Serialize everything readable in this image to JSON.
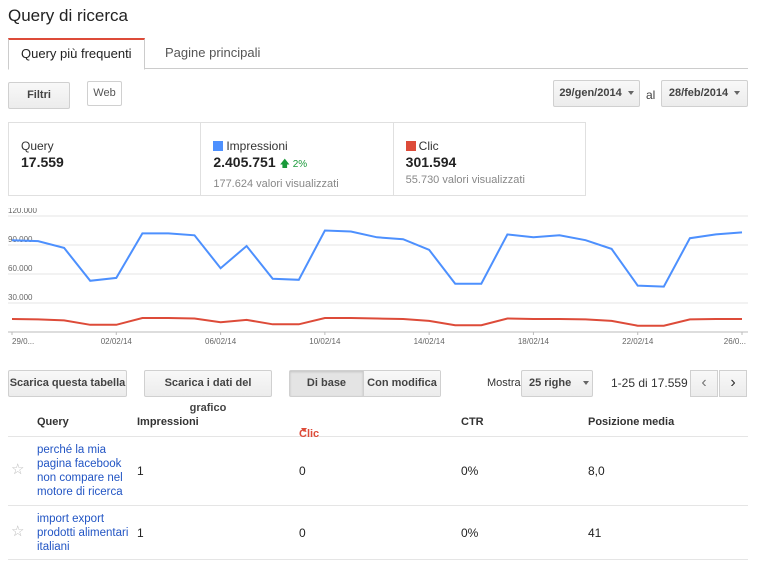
{
  "page_title": "Query di ricerca",
  "tabs": [
    {
      "label": "Query più frequenti",
      "active": true
    },
    {
      "label": "Pagine principali",
      "active": false
    }
  ],
  "filters": {
    "filtri_label": "Filtri",
    "web_label": "Web"
  },
  "date_range": {
    "from": "29/gen/2014",
    "separator": "al",
    "to": "28/feb/2014"
  },
  "stats": [
    {
      "label": "Query",
      "value": "17.559",
      "sub": "",
      "delta": "",
      "color": ""
    },
    {
      "label": "Impressioni",
      "value": "2.405.751",
      "delta": "2%",
      "sub": "177.624 valori visualizzati",
      "color": "#4d90fe"
    },
    {
      "label": "Clic",
      "value": "301.594",
      "sub": "55.730 valori visualizzati",
      "delta": "",
      "color": "#dd4b39"
    }
  ],
  "chart_data": {
    "type": "line",
    "ylim": [
      0,
      120000
    ],
    "y_ticks": [
      "120.000",
      "90.000",
      "60.000",
      "30.000"
    ],
    "x_ticks": [
      "29/0...",
      "02/02/14",
      "06/02/14",
      "10/02/14",
      "14/02/14",
      "18/02/14",
      "22/02/14",
      "26/0..."
    ],
    "series": [
      {
        "name": "Impressioni",
        "color": "#4d90fe",
        "values": [
          95000,
          94000,
          87000,
          53000,
          56000,
          102000,
          102000,
          100000,
          66000,
          89000,
          55000,
          54000,
          105000,
          104000,
          98000,
          96000,
          85000,
          50000,
          50000,
          101000,
          98000,
          100000,
          95000,
          86000,
          48000,
          47000,
          97000,
          101000,
          103000
        ]
      },
      {
        "name": "Clic",
        "color": "#dd4b39",
        "values": [
          13500,
          13000,
          12000,
          7500,
          7500,
          14500,
          14500,
          14000,
          10000,
          12500,
          8000,
          8000,
          14500,
          14500,
          14000,
          13500,
          11500,
          7000,
          7000,
          14000,
          13500,
          13500,
          13000,
          11500,
          6500,
          6500,
          13000,
          13500,
          13500
        ]
      }
    ]
  },
  "toolbar": {
    "download_table": "Scarica questa tabella",
    "download_chart": "Scarica i dati del grafico",
    "basic": "Di base",
    "with_changes": "Con modifica",
    "show_label": "Mostra",
    "rows_select": "25 righe",
    "range_text": "1-25 di 17.559",
    "prev": "‹",
    "next": "›"
  },
  "table": {
    "headers": {
      "query": "Query",
      "impressions": "Impressioni",
      "clicks": "Clic",
      "ctr": "CTR",
      "position": "Posizione media"
    },
    "rows": [
      {
        "query": "perché la mia pagina facebook non compare nel motore di ricerca",
        "impressions": "1",
        "clicks": "0",
        "ctr": "0%",
        "position": "8,0"
      },
      {
        "query": "import export prodotti alimentari italiani",
        "impressions": "1",
        "clicks": "0",
        "ctr": "0%",
        "position": "41"
      }
    ]
  }
}
